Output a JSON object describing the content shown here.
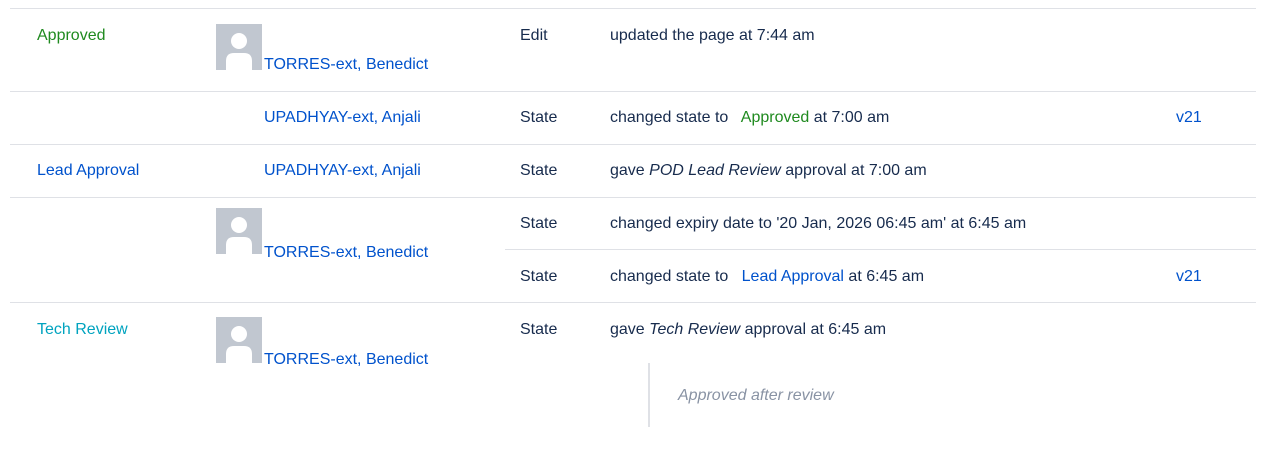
{
  "rows": [
    {
      "state": "Approved",
      "user": "TORRES-ext, Benedict",
      "entries": [
        {
          "type": "Edit",
          "parts": [
            "updated the page at 7:44 am"
          ]
        }
      ]
    },
    {
      "state": "",
      "user": "UPADHYAY-ext, Anjali",
      "entries": [
        {
          "type": "State",
          "pre": "changed state to",
          "state_link": "Approved",
          "post": "at 7:00 am",
          "version": "v21"
        }
      ]
    },
    {
      "state": "Lead Approval",
      "user": "UPADHYAY-ext, Anjali",
      "entries": [
        {
          "type": "State",
          "pre": "gave",
          "em": "POD Lead Review",
          "post": "approval at 7:00 am"
        }
      ]
    },
    {
      "state": "",
      "user": "TORRES-ext, Benedict",
      "entries": [
        {
          "type": "State",
          "text": "changed expiry date to '20 Jan, 2026 06:45 am' at 6:45 am"
        },
        {
          "type": "State",
          "pre": "changed state to",
          "state_link": "Lead Approval",
          "post": "at 6:45 am",
          "version": "v21"
        }
      ]
    },
    {
      "state": "Tech Review",
      "user": "TORRES-ext, Benedict",
      "entries": [
        {
          "type": "State",
          "pre": "gave",
          "em": "Tech Review",
          "post": "approval at 6:45 am"
        }
      ],
      "comment": "Approved after review"
    }
  ],
  "colors": {
    "link": "#0052cc",
    "approved": "#1f8a1f",
    "tech_review": "#00a3bf",
    "divider": "#dfe1e6",
    "avatar": "#c1c7d0",
    "comment": "#8993a4"
  }
}
